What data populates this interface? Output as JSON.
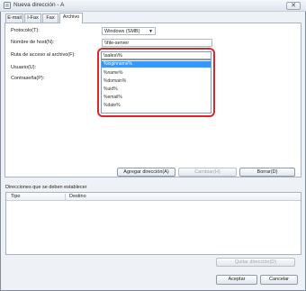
{
  "window": {
    "title": "Nueva dirección - A"
  },
  "tabs": [
    {
      "label": "E-mail"
    },
    {
      "label": "I-Fax"
    },
    {
      "label": "Fax"
    },
    {
      "label": "Archivo"
    }
  ],
  "form": {
    "protocol_label": "Protocolo(T):",
    "protocol_value": "Windows (SMB)",
    "host_label": "Nombre de host(N):",
    "host_value": "\\\\file-server",
    "path_label": "Ruta de acceso al archivo(F):",
    "path_value": "\\sales\\%",
    "user_label": "Usuario(U):",
    "password_label": "Contraseña(P):"
  },
  "dropdown": {
    "items": [
      {
        "label": "%loginname%",
        "selected": true
      },
      {
        "label": "%name%",
        "selected": false
      },
      {
        "label": "%domain%",
        "selected": false
      },
      {
        "label": "%uid%",
        "selected": false
      },
      {
        "label": "%email%",
        "selected": false
      },
      {
        "label": "%date%",
        "selected": false
      }
    ]
  },
  "buttons": {
    "add_address": "Agregar dirección(A)",
    "change": "Cambiar(H)",
    "delete": "Borrar(D)",
    "remove_address": "Quitar dirección(D)",
    "ok": "Aceptar",
    "cancel": "Cancelar"
  },
  "destinations": {
    "section_label": "Direcciones que se deben establecer",
    "columns": [
      "Tipo",
      "Destino"
    ]
  },
  "colors": {
    "highlight": "#e0232b",
    "selection": "#3399ff"
  }
}
